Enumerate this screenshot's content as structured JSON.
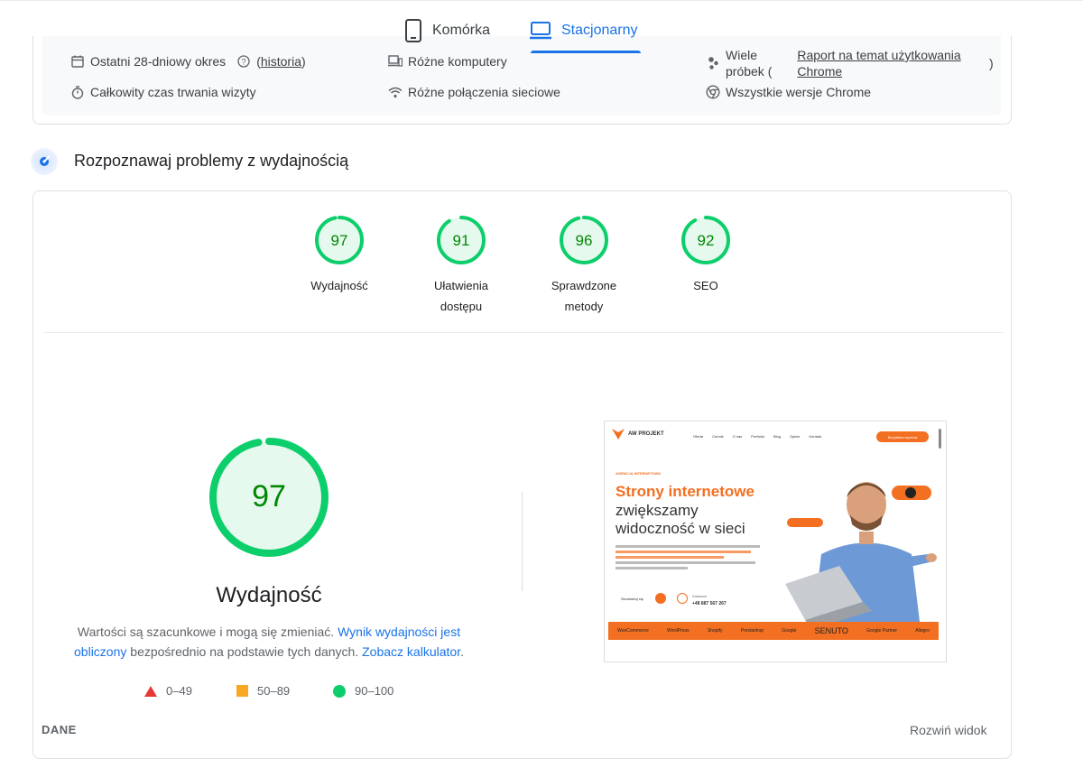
{
  "tabs": [
    {
      "label": "Komórka",
      "icon": "mobile-phone-icon",
      "active": false
    },
    {
      "label": "Stacjonarny",
      "icon": "laptop-icon",
      "active": true
    }
  ],
  "field_info": {
    "period": "Ostatni 28-dniowy okres",
    "history_link": "historia",
    "duration": "Całkowity czas trwania wizyty",
    "devices": "Różne komputery",
    "network": "Różne połączenia sieciowe",
    "samples_prefix_line1": "Wiele",
    "samples_prefix_line2": "próbek (",
    "samples_link_line1": "Raport na temat użytkowania",
    "samples_link_line2": "Chrome",
    "samples_suffix": ")",
    "chrome_versions": "Wszystkie wersje Chrome"
  },
  "section": {
    "title": "Rozpoznawaj problemy z wydajnością"
  },
  "scores": [
    {
      "value": "97",
      "label_line1": "Wydajność",
      "label_line2": ""
    },
    {
      "value": "91",
      "label_line1": "Ułatwienia",
      "label_line2": "dostępu"
    },
    {
      "value": "96",
      "label_line1": "Sprawdzone",
      "label_line2": "metody"
    },
    {
      "value": "92",
      "label_line1": "SEO",
      "label_line2": ""
    }
  ],
  "main_score": {
    "value": "97",
    "label": "Wydajność"
  },
  "description": {
    "text1": "Wartości są szacunkowe i mogą się zmieniać.",
    "link1": "Wynik wydajności jest obliczony",
    "text2": "bezpośrednio na podstawie tych danych.",
    "link2": "Zobacz kalkulator",
    "text3": "."
  },
  "legend": [
    {
      "range": "0–49",
      "shape": "triangle",
      "color": "#e53935"
    },
    {
      "range": "50–89",
      "shape": "square",
      "color": "#f9a825"
    },
    {
      "range": "90–100",
      "shape": "circle",
      "color": "#0cce6b"
    }
  ],
  "screenshot": {
    "brand": "AW PROJEKT",
    "nav": [
      "Oferta",
      "Cennik",
      "O nas",
      "Portfolio",
      "Blog",
      "Opinie",
      "Kontakt"
    ],
    "cta": "Bezpłatna wycena",
    "kicker": "AGENCJA INTERNETOWA",
    "headline": "Strony internetowe",
    "sub1": "zwiększamy",
    "sub2": "widoczność w sieci",
    "phone_label": "Zadzwoń",
    "phone": "+48 887 567 267",
    "contact": "Skontaktuj się",
    "partners": [
      "WooCommerce",
      "WordPress",
      "Shopify",
      "Prestashop",
      "Google",
      "SENUTO",
      "Google Partner",
      "Allegro"
    ]
  },
  "footer": {
    "left": "DANE",
    "right": "Rozwiń widok"
  },
  "colors": {
    "accent": "#1a73e8",
    "good": "#0cce6b",
    "good_bg": "#e6f9ee",
    "good_text": "#008800",
    "brand_orange": "#f36f21"
  }
}
